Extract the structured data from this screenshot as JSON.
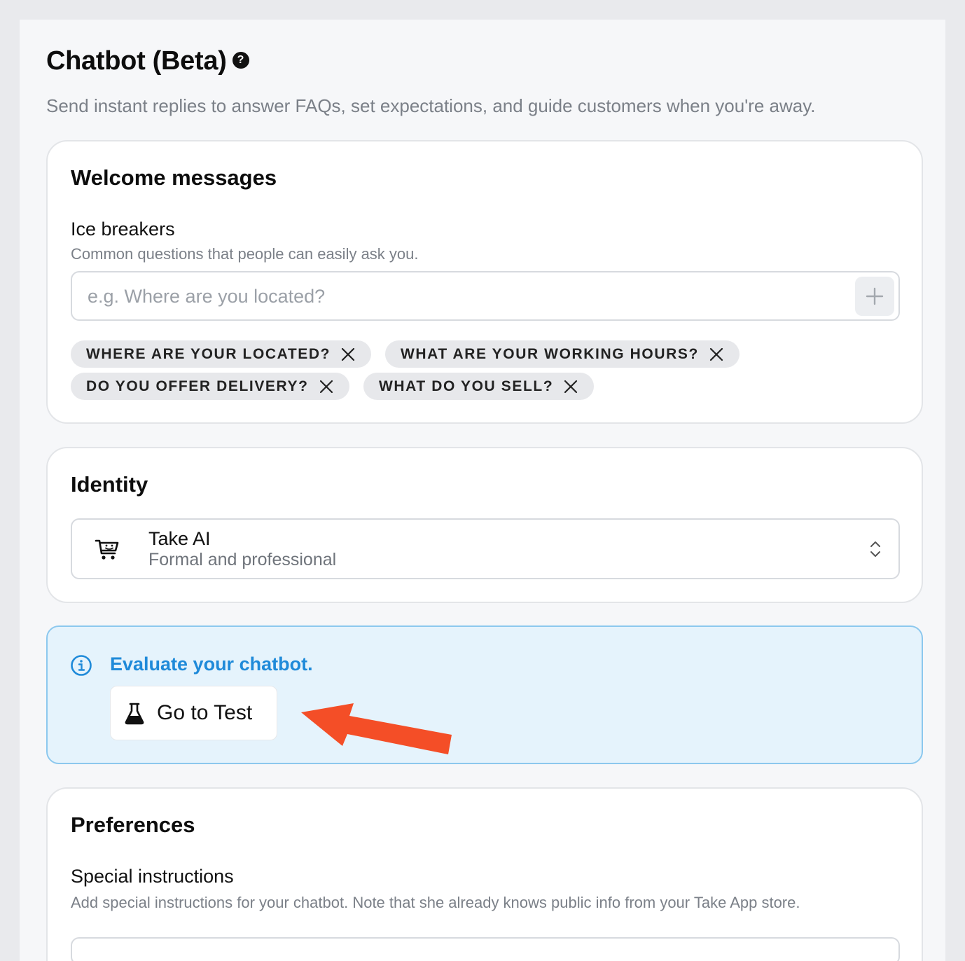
{
  "header": {
    "title": "Chatbot (Beta)",
    "help_glyph": "?",
    "subtitle": "Send instant replies to answer FAQs, set expectations, and guide customers when you're away."
  },
  "welcome": {
    "title": "Welcome messages",
    "ice_breakers": {
      "label": "Ice breakers",
      "help": "Common questions that people can easily ask you.",
      "input_value": "",
      "placeholder": "e.g. Where are you located?",
      "tags": [
        "WHERE ARE YOUR LOCATED?",
        "WHAT ARE YOUR WORKING HOURS?",
        "DO YOU OFFER DELIVERY?",
        "WHAT DO YOU SELL?"
      ]
    }
  },
  "identity": {
    "title": "Identity",
    "selected_name": "Take AI",
    "selected_description": "Formal and professional",
    "icon": "smiling-cart-icon"
  },
  "evaluate": {
    "title": "Evaluate your chatbot.",
    "button_label": "Go to Test",
    "accent_color": "#1f8ad9",
    "background_color": "#e5f3fc"
  },
  "annotation": {
    "arrow_color": "#f44e27"
  },
  "preferences": {
    "title": "Preferences",
    "special_instructions": {
      "label": "Special instructions",
      "help": "Add special instructions for your chatbot. Note that she already knows public info from your Take App store."
    }
  }
}
